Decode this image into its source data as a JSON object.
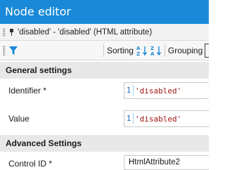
{
  "window": {
    "title": "Node editor"
  },
  "breadcrumb": {
    "text": "'disabled' - 'disabled' (HTML attribute)"
  },
  "toolbar": {
    "sorting_label": "Sorting",
    "grouping_label": "Grouping",
    "search_value": ""
  },
  "sections": {
    "general": {
      "title": "General settings",
      "identifier": {
        "label": "Identifier *",
        "line_number": "1",
        "value": "'disabled'"
      },
      "value": {
        "label": "Value",
        "line_number": "1",
        "value": "'disabled'"
      }
    },
    "advanced": {
      "title": "Advanced Settings",
      "control_id": {
        "label": "Control ID *",
        "value": "HtmlAttribute2"
      }
    }
  },
  "colors": {
    "title_bar": "#1a8ad8",
    "filter_icon": "#1a8ad8",
    "sort_icon": "#1a8ad8",
    "code_string": "#a31515"
  },
  "icons": [
    "pin-icon",
    "filter-icon",
    "sort-ascending-icon",
    "sort-descending-icon"
  ]
}
